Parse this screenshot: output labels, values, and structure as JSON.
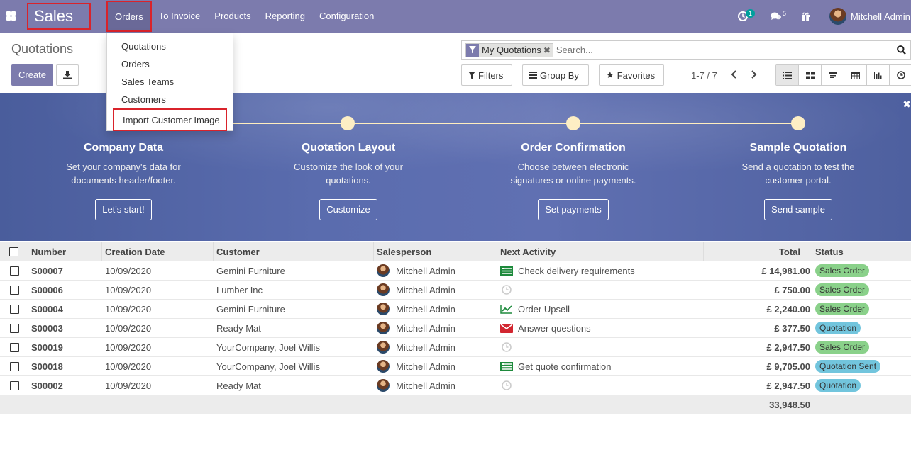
{
  "navbar": {
    "app_title": "Sales",
    "menus": [
      "Orders",
      "To Invoice",
      "Products",
      "Reporting",
      "Configuration"
    ],
    "activity_count": "1",
    "message_count": "5",
    "user_name": "Mitchell Admin"
  },
  "orders_menu": {
    "items": [
      "Quotations",
      "Orders",
      "Sales Teams",
      "Customers",
      "Import Customer Image"
    ]
  },
  "control_panel": {
    "title": "Quotations",
    "create_label": "Create",
    "facet_label": "My Quotations",
    "search_placeholder": "Search...",
    "filters_label": "Filters",
    "group_by_label": "Group By",
    "favorites_label": "Favorites",
    "pager": "1-7 / 7"
  },
  "banner": {
    "steps": [
      {
        "title": "Company Data",
        "desc1": "Set your company's data for",
        "desc2": "documents header/footer.",
        "button": "Let's start!"
      },
      {
        "title": "Quotation Layout",
        "desc1": "Customize the look of your",
        "desc2": "quotations.",
        "button": "Customize"
      },
      {
        "title": "Order Confirmation",
        "desc1": "Choose between electronic",
        "desc2": "signatures or online payments.",
        "button": "Set payments"
      },
      {
        "title": "Sample Quotation",
        "desc1": "Send a quotation to test the",
        "desc2": "customer portal.",
        "button": "Send sample"
      }
    ]
  },
  "table": {
    "headers": [
      "Number",
      "Creation Date",
      "Customer",
      "Salesperson",
      "Next Activity",
      "Total",
      "Status"
    ],
    "rows": [
      {
        "number": "S00007",
        "date": "10/09/2020",
        "customer": "Gemini Furniture",
        "salesperson": "Mitchell Admin",
        "activity_icon": "todo",
        "activity": "Check delivery requirements",
        "total": "£ 14,981.00",
        "status": "Sales Order",
        "status_color": "green"
      },
      {
        "number": "S00006",
        "date": "10/09/2020",
        "customer": "Lumber Inc",
        "salesperson": "Mitchell Admin",
        "activity_icon": "clock",
        "activity": "",
        "total": "£ 750.00",
        "status": "Sales Order",
        "status_color": "green"
      },
      {
        "number": "S00004",
        "date": "10/09/2020",
        "customer": "Gemini Furniture",
        "salesperson": "Mitchell Admin",
        "activity_icon": "upsell",
        "activity": "Order Upsell",
        "total": "£ 2,240.00",
        "status": "Sales Order",
        "status_color": "green"
      },
      {
        "number": "S00003",
        "date": "10/09/2020",
        "customer": "Ready Mat",
        "salesperson": "Mitchell Admin",
        "activity_icon": "email",
        "activity": "Answer questions",
        "total": "£ 377.50",
        "status": "Quotation",
        "status_color": "blue"
      },
      {
        "number": "S00019",
        "date": "10/09/2020",
        "customer": "YourCompany, Joel Willis",
        "salesperson": "Mitchell Admin",
        "activity_icon": "clock",
        "activity": "",
        "total": "£ 2,947.50",
        "status": "Sales Order",
        "status_color": "green"
      },
      {
        "number": "S00018",
        "date": "10/09/2020",
        "customer": "YourCompany, Joel Willis",
        "salesperson": "Mitchell Admin",
        "activity_icon": "todo",
        "activity": "Get quote confirmation",
        "total": "£ 9,705.00",
        "status": "Quotation Sent",
        "status_color": "blue"
      },
      {
        "number": "S00002",
        "date": "10/09/2020",
        "customer": "Ready Mat",
        "salesperson": "Mitchell Admin",
        "activity_icon": "clock",
        "activity": "",
        "total": "£ 2,947.50",
        "status": "Quotation",
        "status_color": "blue"
      }
    ],
    "grand_total": "33,948.50"
  },
  "colors": {
    "brand": "#7c7bad",
    "highlight_border": "#d9232b",
    "status_green": "#8ad18a",
    "status_blue": "#72c5dd"
  }
}
